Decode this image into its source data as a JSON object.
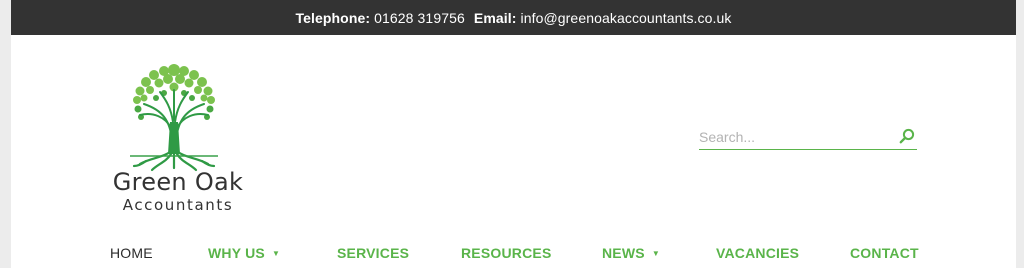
{
  "topbar": {
    "phone_label": "Telephone:",
    "phone": "01628 319756",
    "email_label": "Email:",
    "email": "info@greenoakaccountants.co.uk"
  },
  "logo": {
    "name": "Green Oak",
    "subtitle": "Accountants"
  },
  "search": {
    "placeholder": "Search..."
  },
  "nav": {
    "items": [
      {
        "label": "HOME",
        "active": true
      },
      {
        "label": "WHY US",
        "dropdown": true
      },
      {
        "label": "SERVICES"
      },
      {
        "label": "RESOURCES"
      },
      {
        "label": "NEWS",
        "dropdown": true
      },
      {
        "label": "VACANCIES"
      },
      {
        "label": "CONTACT"
      }
    ],
    "caret": "▼"
  },
  "colors": {
    "brand_green": "#5ab44a",
    "topbar_bg": "#333333",
    "text_dark": "#2b2b2b"
  },
  "icons": [
    "search-icon",
    "oak-tree-icon",
    "caret-down-icon"
  ]
}
